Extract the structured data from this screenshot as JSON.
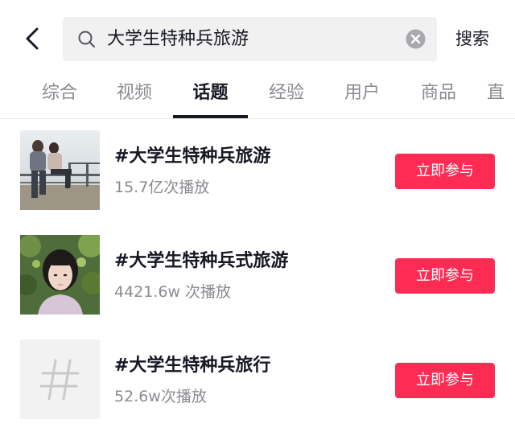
{
  "header": {
    "back_icon": "chevron-left-icon",
    "search_icon": "search-icon",
    "query": "大学生特种兵旅游",
    "clear_icon": "clear-circle-icon",
    "search_label": "搜索"
  },
  "tabs": [
    {
      "label": "综合",
      "active": false
    },
    {
      "label": "视频",
      "active": false
    },
    {
      "label": "话题",
      "active": true
    },
    {
      "label": "经验",
      "active": false
    },
    {
      "label": "用户",
      "active": false
    },
    {
      "label": "商品",
      "active": false
    },
    {
      "label": "直",
      "active": false
    }
  ],
  "topics": [
    {
      "title": "#大学生特种兵旅游",
      "plays": "15.7亿次播放",
      "button": "立即参与",
      "thumb": "photo-students-at-railing"
    },
    {
      "title": "#大学生特种兵式旅游",
      "plays": "4421.6w 次播放",
      "button": "立即参与",
      "thumb": "photo-girl-portrait"
    },
    {
      "title": "#大学生特种兵旅行",
      "plays": "52.6w次播放",
      "button": "立即参与",
      "thumb": "hashtag-placeholder-icon"
    }
  ],
  "colors": {
    "accent": "#fe2c55",
    "text_primary": "#161823",
    "text_secondary": "#8a8b91",
    "search_bg": "#f1f1f2"
  }
}
